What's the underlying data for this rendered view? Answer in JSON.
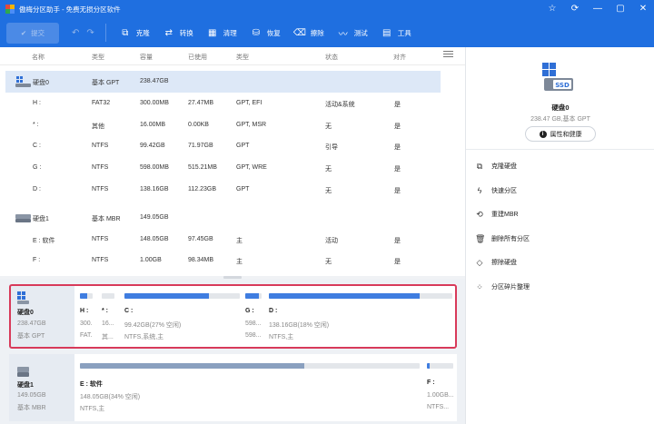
{
  "window": {
    "title": "傲梅分区助手 - 免费无损分区软件",
    "controls": [
      "star-icon",
      "refresh-icon",
      "minimize-icon",
      "maximize-icon",
      "close-icon"
    ]
  },
  "toolbar": {
    "commit_label": "提交",
    "buttons": [
      {
        "label": "克隆",
        "icon": "clone-icon"
      },
      {
        "label": "转换",
        "icon": "convert-icon"
      },
      {
        "label": "清理",
        "icon": "clean-icon"
      },
      {
        "label": "恢复",
        "icon": "recover-icon"
      },
      {
        "label": "擦除",
        "icon": "wipe-icon"
      },
      {
        "label": "测试",
        "icon": "test-icon"
      },
      {
        "label": "工具",
        "icon": "tools-icon"
      }
    ]
  },
  "table": {
    "headers": [
      "名称",
      "类型",
      "容量",
      "已使用",
      "类型",
      "状态",
      "对齐"
    ],
    "rows": [
      {
        "kind": "disk",
        "name": "硬盘0",
        "type": "基本 GPT",
        "capacity": "238.47GB",
        "used": "",
        "fs": "",
        "status": "",
        "align": ""
      },
      {
        "kind": "part",
        "name": "H :",
        "type": "FAT32",
        "capacity": "300.00MB",
        "used": "27.47MB",
        "fs": "GPT, EFI",
        "status": "活动&系统",
        "align": "是"
      },
      {
        "kind": "part",
        "name": "* :",
        "type": "其他",
        "capacity": "16.00MB",
        "used": "0.00KB",
        "fs": "GPT, MSR",
        "status": "无",
        "align": "是"
      },
      {
        "kind": "part",
        "name": "C :",
        "type": "NTFS",
        "capacity": "99.42GB",
        "used": "71.97GB",
        "fs": "GPT",
        "status": "引导",
        "align": "是"
      },
      {
        "kind": "part",
        "name": "G :",
        "type": "NTFS",
        "capacity": "598.00MB",
        "used": "515.21MB",
        "fs": "GPT, WRE",
        "status": "无",
        "align": "是"
      },
      {
        "kind": "part",
        "name": "D :",
        "type": "NTFS",
        "capacity": "138.16GB",
        "used": "112.23GB",
        "fs": "GPT",
        "status": "无",
        "align": "是"
      },
      {
        "kind": "disk",
        "name": "硬盘1",
        "type": "基本 MBR",
        "capacity": "149.05GB",
        "used": "",
        "fs": "",
        "status": "",
        "align": ""
      },
      {
        "kind": "part",
        "name": "E : 软件",
        "type": "NTFS",
        "capacity": "148.05GB",
        "used": "97.45GB",
        "fs": "主",
        "status": "活动",
        "align": "是"
      },
      {
        "kind": "part",
        "name": "F :",
        "type": "NTFS",
        "capacity": "1.00GB",
        "used": "98.34MB",
        "fs": "主",
        "status": "无",
        "align": "是"
      }
    ]
  },
  "diskmap": {
    "disks": [
      {
        "name": "硬盘0",
        "size": "238.47GB",
        "type": "基本 GPT",
        "parts": [
          {
            "label": "H :",
            "size": "300...",
            "fs": "FAT...",
            "used": 0.6
          },
          {
            "label": "* :",
            "size": "16...",
            "fs": "其...",
            "used": 0.0
          },
          {
            "label": "C :",
            "size": "99.42GB(27% 空闲)",
            "fs": "NTFS,系统,主",
            "used": 0.73
          },
          {
            "label": "G :",
            "size": "598...",
            "fs": "598...",
            "used": 0.86
          },
          {
            "label": "D :",
            "size": "138.16GB(18% 空闲)",
            "fs": "NTFS,主",
            "used": 0.82
          }
        ]
      },
      {
        "name": "硬盘1",
        "size": "149.05GB",
        "type": "基本 MBR",
        "parts": [
          {
            "label": "E : 软件",
            "size": "148.05GB(34% 空闲)",
            "fs": "NTFS,主",
            "used": 0.66
          },
          {
            "label": "F :",
            "size": "1.00GB...",
            "fs": "NTFS...",
            "used": 0.1
          }
        ]
      }
    ]
  },
  "panel": {
    "disk_name": "硬盘0",
    "disk_sub": "238.47 GB,基本 GPT",
    "prop_button": "属性和健康",
    "operations": [
      {
        "label": "克隆硬盘",
        "icon": "clone-disk-icon"
      },
      {
        "label": "快速分区",
        "icon": "lightning-icon"
      },
      {
        "label": "重建MBR",
        "icon": "rebuild-icon"
      },
      {
        "label": "删除所有分区",
        "icon": "trash-icon"
      },
      {
        "label": "擦除硬盘",
        "icon": "eraser-icon"
      },
      {
        "label": "分区碎片整理",
        "icon": "defrag-icon"
      }
    ]
  },
  "colors": {
    "accent": "#1f6fe0",
    "bar": "#3f7de0",
    "highlight": "#d83a5a"
  }
}
